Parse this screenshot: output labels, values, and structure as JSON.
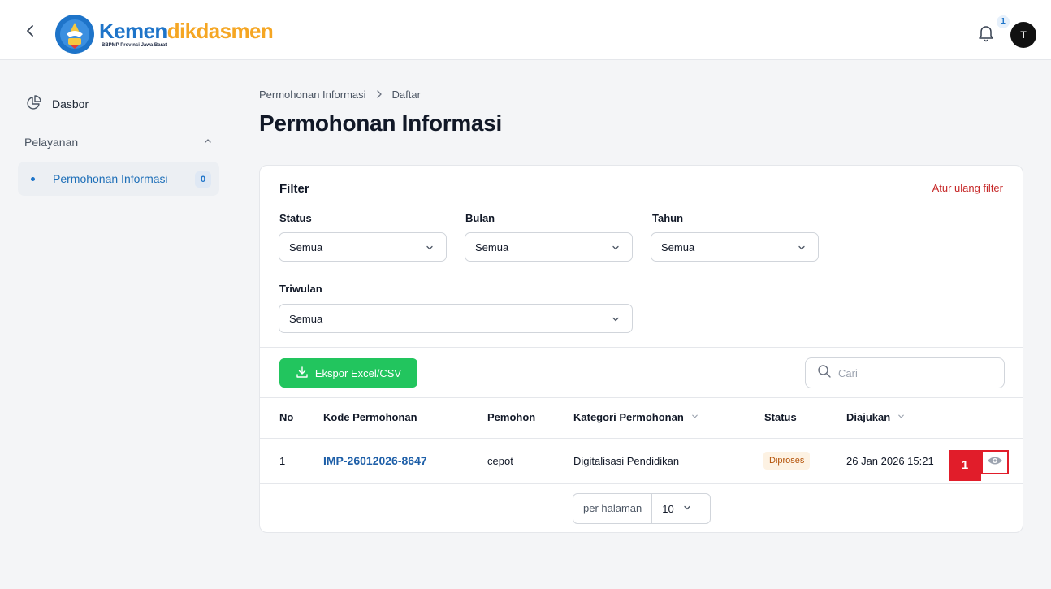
{
  "header": {
    "brand_part1": "Kemen",
    "brand_part2": "dikdasmen",
    "brand_sub": "BBPMP Provinsi Jawa Barat",
    "notification_count": "1",
    "avatar_initial": "T",
    "icons": [
      "back-arrow-icon",
      "bell-icon"
    ]
  },
  "sidebar": {
    "dashboard_label": "Dasbor",
    "section_label": "Pelayanan",
    "items": [
      {
        "label": "Permohonan Informasi",
        "count": "0",
        "active": true
      }
    ]
  },
  "breadcrumb": {
    "items": [
      "Permohonan Informasi",
      "Daftar"
    ]
  },
  "page_title": "Permohonan Informasi",
  "filter": {
    "title": "Filter",
    "reset_label": "Atur ulang filter",
    "status": {
      "label": "Status",
      "value": "Semua"
    },
    "bulan": {
      "label": "Bulan",
      "value": "Semua"
    },
    "tahun": {
      "label": "Tahun",
      "value": "Semua"
    },
    "triwulan": {
      "label": "Triwulan",
      "value": "Semua"
    }
  },
  "toolbar": {
    "export_label": "Ekspor Excel/CSV",
    "search_placeholder": "Cari"
  },
  "table": {
    "columns": [
      "No",
      "Kode Permohonan",
      "Pemohon",
      "Kategori Permohonan",
      "Status",
      "Diajukan"
    ],
    "rows": [
      {
        "no": "1",
        "kode": "IMP-26012026-8647",
        "pemohon": "cepot",
        "kategori": "Digitalisasi Pendidikan",
        "status": "Diproses",
        "diajukan": "26 Jan 2026 15:21"
      }
    ]
  },
  "pagination": {
    "label": "per halaman",
    "value": "10"
  },
  "annotation_marker": "1",
  "colors": {
    "brand_blue": "#1e74c9",
    "brand_orange": "#f5a623",
    "export_green": "#22c55e",
    "reset_red": "#c62828",
    "marker_red": "#e11d2a",
    "status_badge_bg": "#fdf2e3",
    "status_badge_text": "#b45309"
  }
}
